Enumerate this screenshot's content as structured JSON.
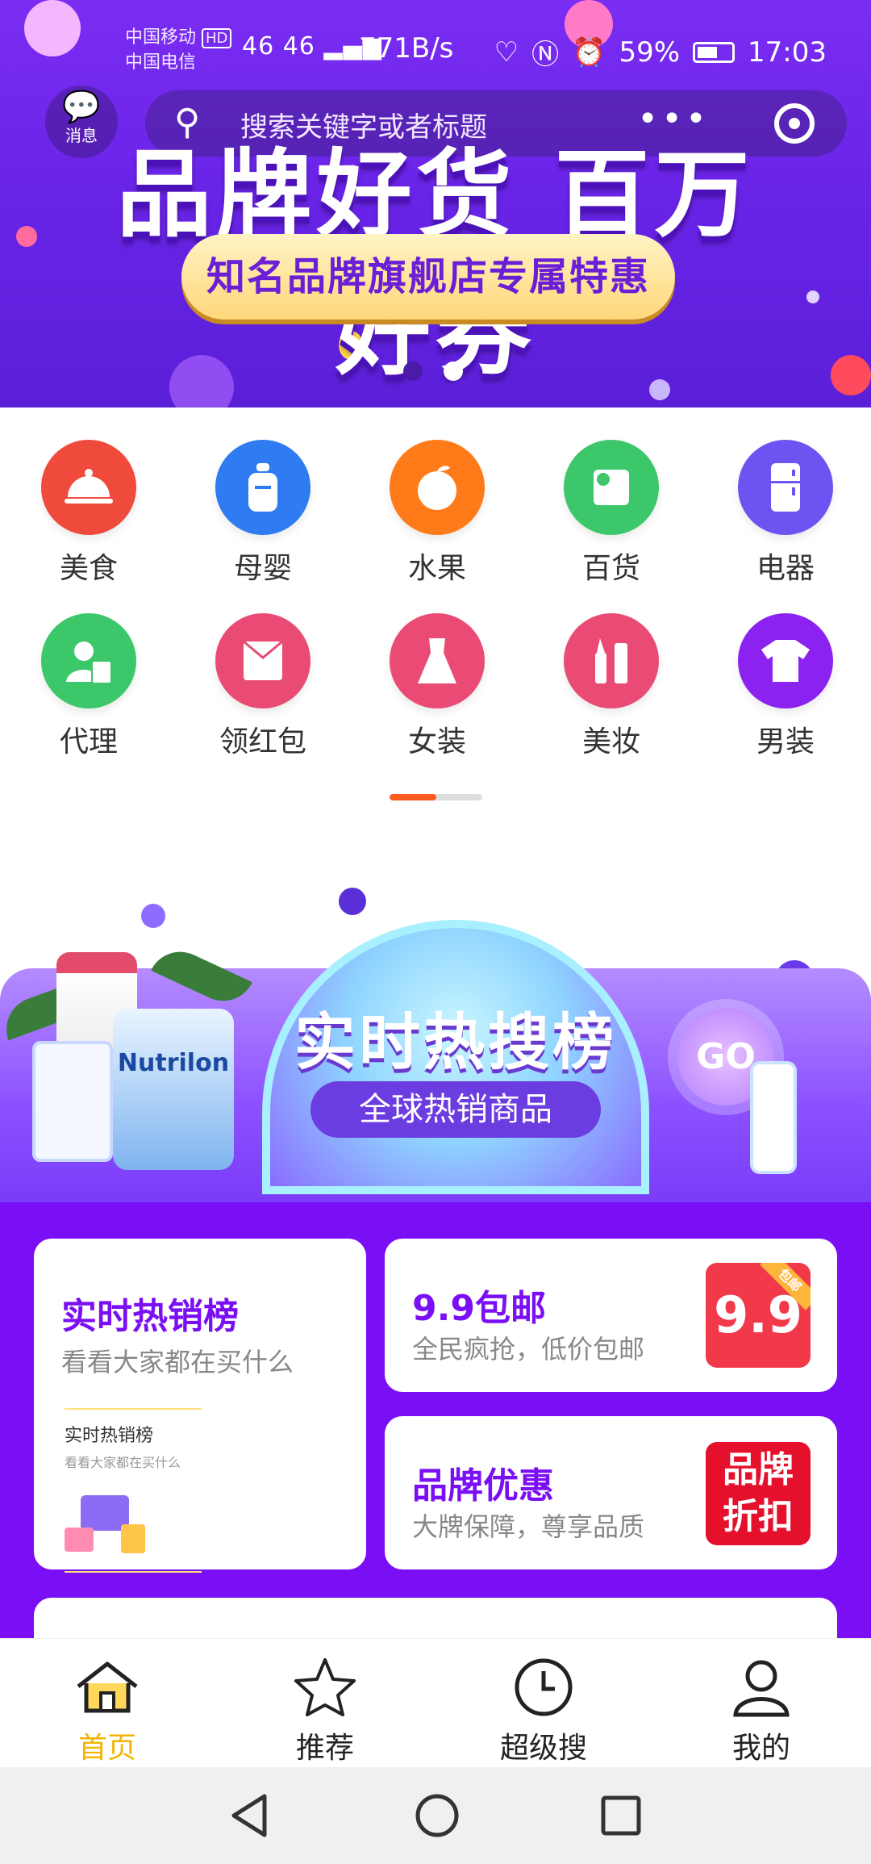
{
  "status_bar": {
    "carrier_1": "中国移动",
    "hd": "HD",
    "carrier_2": "中国电信",
    "network": "46 46",
    "speed": "771B/s",
    "battery_percent": "59%",
    "time": "17:03"
  },
  "header": {
    "message_label": "消息",
    "search_placeholder": "搜索关键字或者标题"
  },
  "hero_banner": {
    "title": "品牌好货 百万好券",
    "subtitle": "知名品牌旗舰店专属特惠",
    "page_indicator": {
      "count": 2,
      "active_index": 1
    }
  },
  "categories": [
    {
      "label": "美食",
      "icon": "cloche-icon",
      "color": "#ef4a3c"
    },
    {
      "label": "母婴",
      "icon": "baby-bottle-icon",
      "color": "#2f7bf1"
    },
    {
      "label": "水果",
      "icon": "peach-icon",
      "color": "#ff7b1a"
    },
    {
      "label": "百货",
      "icon": "paper-roll-icon",
      "color": "#3cc76a"
    },
    {
      "label": "电器",
      "icon": "refrigerator-icon",
      "color": "#6f53f2"
    },
    {
      "label": "代理",
      "icon": "agent-icon",
      "color": "#3cc76a"
    },
    {
      "label": "领红包",
      "icon": "red-envelope-icon",
      "color": "#e94b74"
    },
    {
      "label": "女装",
      "icon": "dress-icon",
      "color": "#e94b74"
    },
    {
      "label": "美妆",
      "icon": "makeup-icon",
      "color": "#e94b74"
    },
    {
      "label": "男装",
      "icon": "tshirt-icon",
      "color": "#8b22f0"
    }
  ],
  "category_pager": {
    "active_fraction": 0.5
  },
  "hot_banner": {
    "title": "实时热搜榜",
    "subtitle": "全球热销商品",
    "go_label": "GO",
    "product_label": "Nutrilon"
  },
  "promo_cards": {
    "hot_sales": {
      "title": "实时热销榜",
      "subtitle": "看看大家都在买什么",
      "mini_title": "实时热销榜",
      "mini_subtitle": "看看大家都在买什么"
    },
    "free_shipping": {
      "title": "9.9包邮",
      "subtitle": "全民疯抢，低价包邮",
      "badge": "9.9",
      "badge_ribbon": "包邮"
    },
    "brand_deals": {
      "title": "品牌优惠",
      "subtitle": "大牌保障，尊享品质",
      "badge_line1": "品牌",
      "badge_line2": "折扣"
    }
  },
  "tab_bar": [
    {
      "label": "首页",
      "icon": "home-icon",
      "active": true
    },
    {
      "label": "推荐",
      "icon": "star-icon",
      "active": false
    },
    {
      "label": "超级搜",
      "icon": "clock-icon",
      "active": false
    },
    {
      "label": "我的",
      "icon": "user-icon",
      "active": false
    }
  ],
  "colors": {
    "brand_purple": "#7a0ff5",
    "active_tab": "#f1b400",
    "pager_active": "#ff5a1f"
  }
}
